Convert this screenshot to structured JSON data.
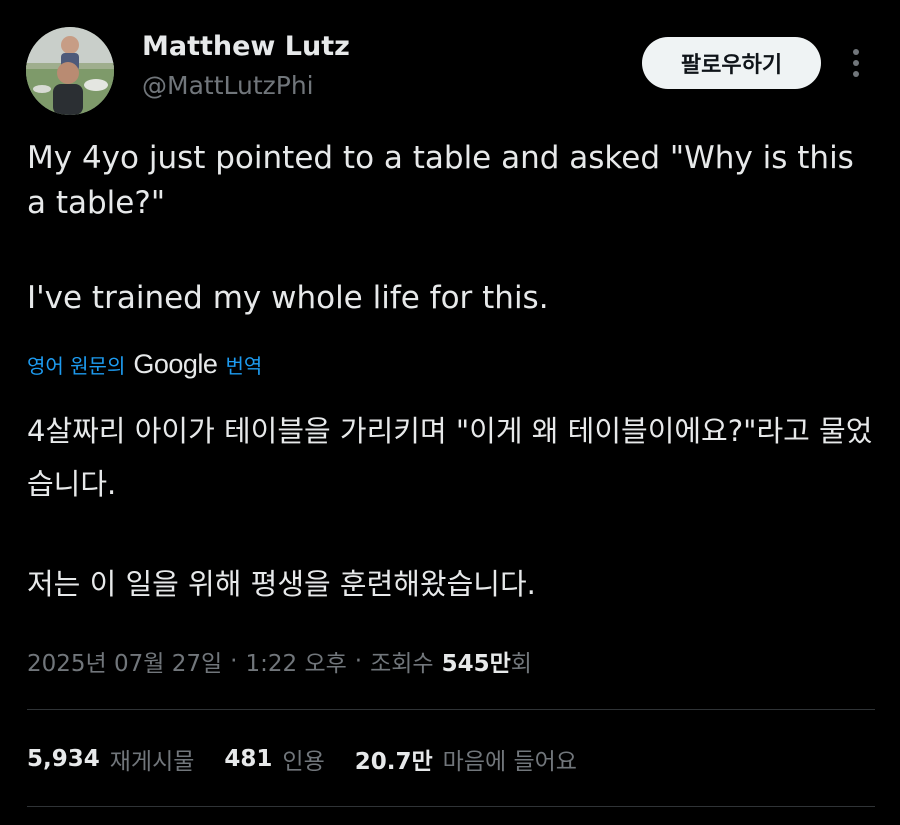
{
  "author": {
    "display_name": "Matthew Lutz",
    "handle": "@MattLutzPhi"
  },
  "header": {
    "follow_label": "팔로우하기",
    "more_icon": "more-vertical-icon"
  },
  "tweet": {
    "text_line_1": "My 4yo just pointed to a table and asked \"Why is this a table?\"",
    "text_line_2": "I've trained my whole life for this."
  },
  "translation": {
    "prefix": "영어 원문의",
    "engine": "Google",
    "suffix": "번역",
    "text_line_1": "4살짜리 아이가 테이블을 가리키며 \"이게 왜 테이블이에요?\"라고 물었습니다.",
    "text_line_2": "저는 이 일을 위해 평생을 훈련해왔습니다."
  },
  "meta": {
    "date": "2025년 07월 27일",
    "separator": "·",
    "time": "1:22 오후",
    "views_label": "조회수",
    "views_count": "545만",
    "views_suffix": "회"
  },
  "stats": {
    "reposts_count": "5,934",
    "reposts_label": "재게시물",
    "quotes_count": "481",
    "quotes_label": "인용",
    "likes_count": "20.7만",
    "likes_label": "마음에 들어요"
  },
  "colors": {
    "background": "#000000",
    "text": "#e7e9ea",
    "secondary_text": "#71767b",
    "link": "#1d9bf0",
    "follow_button_bg": "#eff3f4"
  }
}
